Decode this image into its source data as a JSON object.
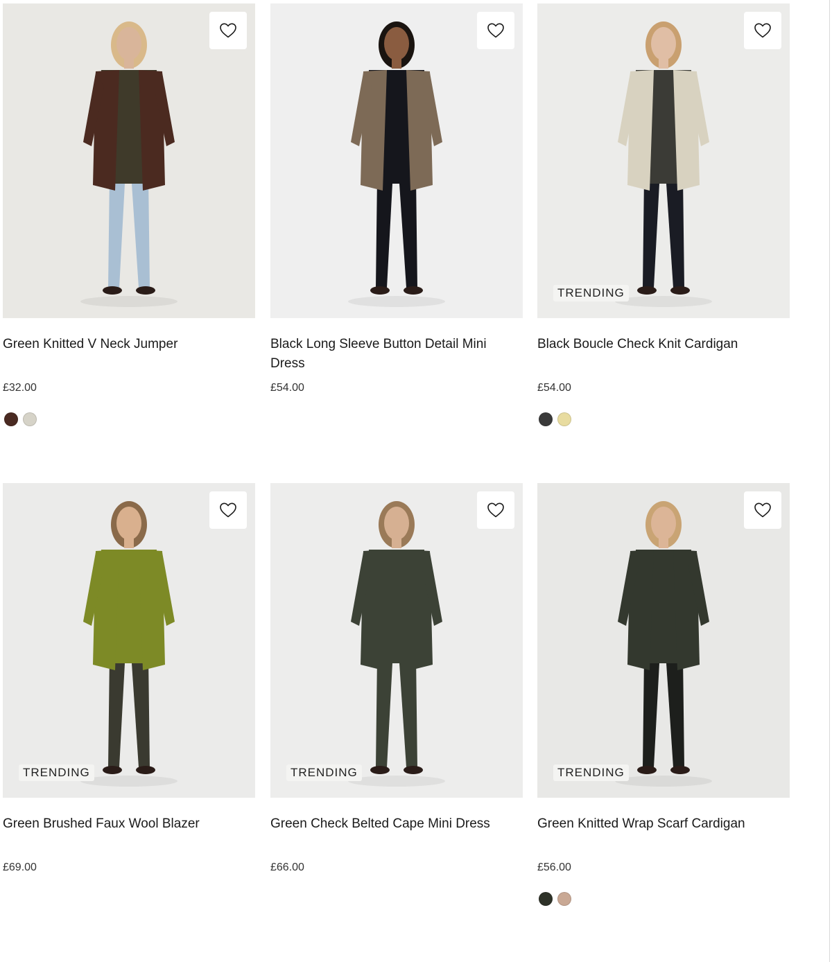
{
  "products": [
    {
      "title": "Green Knitted V Neck Jumper",
      "price": "£32.00",
      "badge": "",
      "swatches": [
        "#4a2a22",
        "#d6d3c8"
      ],
      "bg": "#e9e8e4",
      "figure": {
        "top": "#3f3a2a",
        "jacket": "#4b2a20",
        "bottom": "#a9bfd3",
        "skin": "#d9b59a",
        "hair": "#d9b98a"
      }
    },
    {
      "title": "Black Long Sleeve Button Detail Mini Dress",
      "price": "£54.00",
      "badge": "",
      "swatches": [],
      "bg": "#efefef",
      "figure": {
        "top": "#15161c",
        "jacket": "#7d6a56",
        "bottom": "#15161c",
        "skin": "#8a5c40",
        "hair": "#1a1410"
      }
    },
    {
      "title": "Black Boucle Check Knit Cardigan",
      "price": "£54.00",
      "badge": "TRENDING",
      "swatches": [
        "#3a3a3a",
        "#e8dca0"
      ],
      "bg": "#ececea",
      "figure": {
        "top": "#3b3b36",
        "jacket": "#d8d2c0",
        "bottom": "#1a1c24",
        "skin": "#e0bea5",
        "hair": "#c9a070"
      }
    },
    {
      "title": "Green Brushed Faux Wool Blazer",
      "price": "£69.00",
      "badge": "TRENDING",
      "swatches": [],
      "bg": "#ebebea",
      "figure": {
        "top": "#7d8a26",
        "jacket": "#7d8a26",
        "bottom": "#3a3a30",
        "skin": "#d9b08e",
        "hair": "#8a6a4a"
      }
    },
    {
      "title": "Green Check Belted Cape Mini Dress",
      "price": "£66.00",
      "badge": "TRENDING",
      "swatches": [],
      "bg": "#ededec",
      "figure": {
        "top": "#3c4236",
        "jacket": "#3c4236",
        "bottom": "#3c4236",
        "skin": "#d6b092",
        "hair": "#9a7a58"
      }
    },
    {
      "title": "Green Knitted Wrap Scarf Cardigan",
      "price": "£56.00",
      "badge": "TRENDING",
      "swatches": [
        "#2e3228",
        "#c9a894"
      ],
      "bg": "#e8e8e6",
      "figure": {
        "top": "#33382e",
        "jacket": "#33382e",
        "bottom": "#1d1f1c",
        "skin": "#dcb597",
        "hair": "#c9a474"
      }
    }
  ]
}
